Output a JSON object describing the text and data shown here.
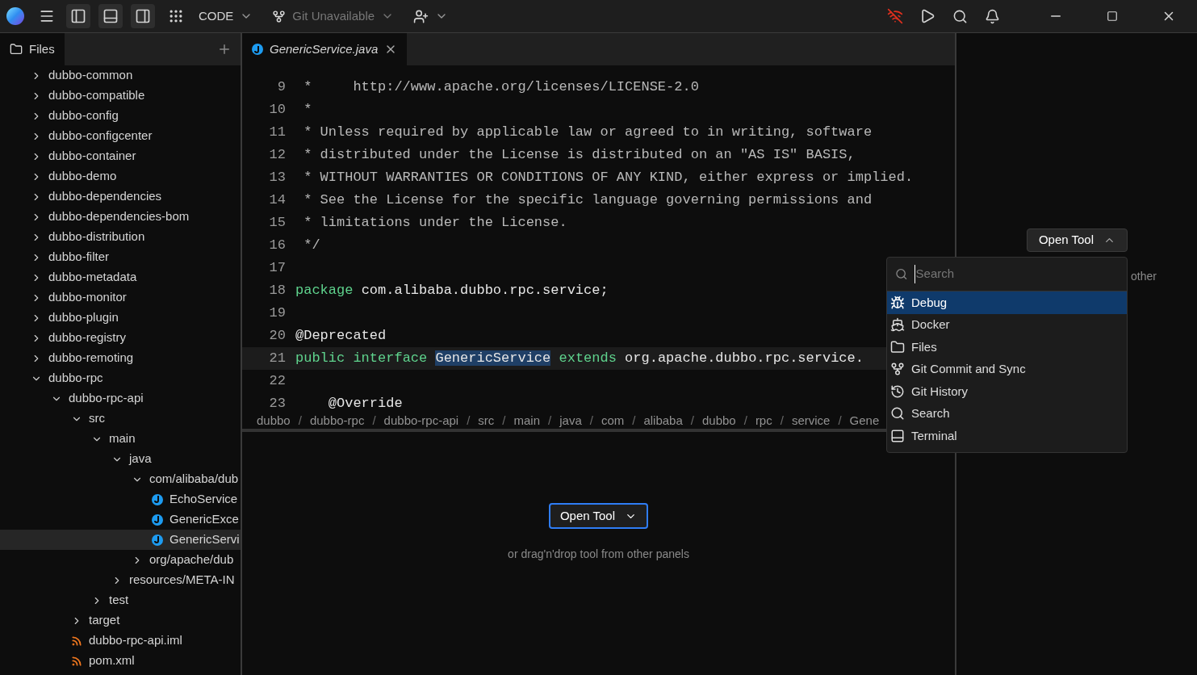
{
  "toolbar": {
    "panel_toggles": [
      {
        "on": true
      },
      {
        "on": true
      },
      {
        "on": true
      }
    ],
    "mode": "CODE",
    "git": {
      "label": "Git Unavailable",
      "disabled": true
    }
  },
  "files_panel": {
    "tab": "Files",
    "tree": [
      {
        "name": "dubbo-common",
        "kind": "folder",
        "expanded": false,
        "selected": false
      },
      {
        "name": "dubbo-compatible",
        "kind": "folder",
        "expanded": false,
        "selected": false
      },
      {
        "name": "dubbo-config",
        "kind": "folder",
        "expanded": false,
        "selected": false
      },
      {
        "name": "dubbo-configcenter",
        "kind": "folder",
        "expanded": false,
        "selected": false
      },
      {
        "name": "dubbo-container",
        "kind": "folder",
        "expanded": false,
        "selected": false
      },
      {
        "name": "dubbo-demo",
        "kind": "folder",
        "expanded": false,
        "selected": false
      },
      {
        "name": "dubbo-dependencies",
        "kind": "folder",
        "expanded": false,
        "selected": false
      },
      {
        "name": "dubbo-dependencies-bom",
        "kind": "folder",
        "expanded": false,
        "selected": false
      },
      {
        "name": "dubbo-distribution",
        "kind": "folder",
        "expanded": false,
        "selected": false
      },
      {
        "name": "dubbo-filter",
        "kind": "folder",
        "expanded": false,
        "selected": false
      },
      {
        "name": "dubbo-metadata",
        "kind": "folder",
        "expanded": false,
        "selected": false
      },
      {
        "name": "dubbo-monitor",
        "kind": "folder",
        "expanded": false,
        "selected": false
      },
      {
        "name": "dubbo-plugin",
        "kind": "folder",
        "expanded": false,
        "selected": false
      },
      {
        "name": "dubbo-registry",
        "kind": "folder",
        "expanded": false,
        "selected": false
      },
      {
        "name": "dubbo-remoting",
        "kind": "folder",
        "expanded": false,
        "selected": false
      },
      {
        "name": "dubbo-rpc",
        "kind": "folder",
        "expanded": true,
        "selected": false,
        "children": [
          {
            "name": "dubbo-rpc-api",
            "kind": "folder",
            "expanded": true,
            "selected": false,
            "children": [
              {
                "name": "src",
                "kind": "folder",
                "expanded": true,
                "selected": false,
                "children": [
                  {
                    "name": "main",
                    "kind": "folder",
                    "expanded": true,
                    "selected": false,
                    "children": [
                      {
                        "name": "java",
                        "kind": "folder",
                        "expanded": true,
                        "selected": false,
                        "children": [
                          {
                            "name": "com/alibaba/dub",
                            "kind": "folder",
                            "expanded": true,
                            "selected": false,
                            "children": [
                              {
                                "name": "EchoService",
                                "kind": "java",
                                "selected": false
                              },
                              {
                                "name": "GenericExce",
                                "kind": "java",
                                "selected": false
                              },
                              {
                                "name": "GenericServi",
                                "kind": "java",
                                "selected": true
                              }
                            ]
                          },
                          {
                            "name": "org/apache/dub",
                            "kind": "folder",
                            "expanded": false,
                            "selected": false
                          }
                        ]
                      },
                      {
                        "name": "resources/META-IN",
                        "kind": "folder",
                        "expanded": false,
                        "selected": false
                      }
                    ]
                  },
                  {
                    "name": "test",
                    "kind": "folder",
                    "expanded": false,
                    "selected": false
                  }
                ]
              },
              {
                "name": "target",
                "kind": "folder",
                "expanded": false,
                "selected": false
              },
              {
                "name": "dubbo-rpc-api.iml",
                "kind": "feed",
                "selected": false
              },
              {
                "name": "pom.xml",
                "kind": "feed",
                "selected": false
              }
            ]
          }
        ]
      }
    ]
  },
  "editor": {
    "tab": {
      "title": "GenericService.java",
      "preview": true
    },
    "lines": [
      {
        "number": "9",
        "current": false,
        "tokens": [
          {
            "kind": "comment",
            "text": " *     http://www.apache.org/licenses/LICENSE-2.0"
          }
        ]
      },
      {
        "number": "10",
        "current": false,
        "tokens": [
          {
            "kind": "comment",
            "text": " *"
          }
        ]
      },
      {
        "number": "11",
        "current": false,
        "tokens": [
          {
            "kind": "comment",
            "text": " * Unless required by applicable law or agreed to in writing, software"
          }
        ]
      },
      {
        "number": "12",
        "current": false,
        "tokens": [
          {
            "kind": "comment",
            "text": " * distributed under the License is distributed on an \"AS IS\" BASIS,"
          }
        ]
      },
      {
        "number": "13",
        "current": false,
        "tokens": [
          {
            "kind": "comment",
            "text": " * WITHOUT WARRANTIES OR CONDITIONS OF ANY KIND, either express or implied."
          }
        ]
      },
      {
        "number": "14",
        "current": false,
        "tokens": [
          {
            "kind": "comment",
            "text": " * See the License for the specific language governing permissions and"
          }
        ]
      },
      {
        "number": "15",
        "current": false,
        "tokens": [
          {
            "kind": "comment",
            "text": " * limitations under the License."
          }
        ]
      },
      {
        "number": "16",
        "current": false,
        "tokens": [
          {
            "kind": "comment",
            "text": " */"
          }
        ]
      },
      {
        "number": "17",
        "current": false
      },
      {
        "number": "18",
        "current": false,
        "tokens": [
          {
            "kind": "keyword",
            "text": "package"
          },
          {
            "kind": "plain",
            "text": "com.alibaba.dubbo.rpc.service;"
          }
        ]
      },
      {
        "number": "19",
        "current": false
      },
      {
        "number": "20",
        "current": false,
        "tokens": [
          {
            "kind": "plain",
            "text": "@Deprecated"
          }
        ]
      },
      {
        "number": "21",
        "current": true,
        "tokens": [
          {
            "kind": "keyword",
            "text": "public"
          },
          {
            "kind": "keyword",
            "text": "interface"
          },
          {
            "kind": "selection",
            "text": "GenericService"
          },
          {
            "kind": "keyword",
            "text": "extends"
          },
          {
            "kind": "plain",
            "text": "org.apache.dubbo.rpc.service."
          }
        ]
      },
      {
        "number": "22",
        "current": false
      },
      {
        "number": "23",
        "current": false,
        "tokens": [
          {
            "kind": "plain",
            "text": "    @Override"
          }
        ]
      }
    ],
    "breadcrumb": [
      {
        "kind": "crumb",
        "text": "dubbo"
      },
      {
        "kind": "separator",
        "text": "/"
      },
      {
        "kind": "crumb",
        "text": "dubbo-rpc"
      },
      {
        "kind": "separator",
        "text": "/"
      },
      {
        "kind": "crumb",
        "text": "dubbo-rpc-api"
      },
      {
        "kind": "separator",
        "text": "/"
      },
      {
        "kind": "crumb",
        "text": "src"
      },
      {
        "kind": "separator",
        "text": "/"
      },
      {
        "kind": "crumb",
        "text": "main"
      },
      {
        "kind": "separator",
        "text": "/"
      },
      {
        "kind": "crumb",
        "text": "java"
      },
      {
        "kind": "separator",
        "text": "/"
      },
      {
        "kind": "crumb",
        "text": "com"
      },
      {
        "kind": "separator",
        "text": "/"
      },
      {
        "kind": "crumb",
        "text": "alibaba"
      },
      {
        "kind": "separator",
        "text": "/"
      },
      {
        "kind": "crumb",
        "text": "dubbo"
      },
      {
        "kind": "separator",
        "text": "/"
      },
      {
        "kind": "crumb",
        "text": "rpc"
      },
      {
        "kind": "separator",
        "text": "/"
      },
      {
        "kind": "crumb",
        "text": "service"
      },
      {
        "kind": "separator",
        "text": "/"
      },
      {
        "kind": "crumb",
        "text": "Gene"
      }
    ]
  },
  "bottom_panel": {
    "button": "Open Tool",
    "focused": true,
    "hint": "or drag'n'drop tool from other panels"
  },
  "right_panel": {
    "button": "Open Tool",
    "hint": "other"
  },
  "tool_menu": {
    "placeholder": "Search",
    "items": [
      {
        "label": "Debug",
        "selected": true
      },
      {
        "label": "Docker",
        "selected": false
      },
      {
        "label": "Files",
        "selected": false
      },
      {
        "label": "Git Commit and Sync",
        "selected": false
      },
      {
        "label": "Git History",
        "selected": false
      },
      {
        "label": "Search",
        "selected": false
      },
      {
        "label": "Terminal",
        "selected": false
      }
    ]
  }
}
